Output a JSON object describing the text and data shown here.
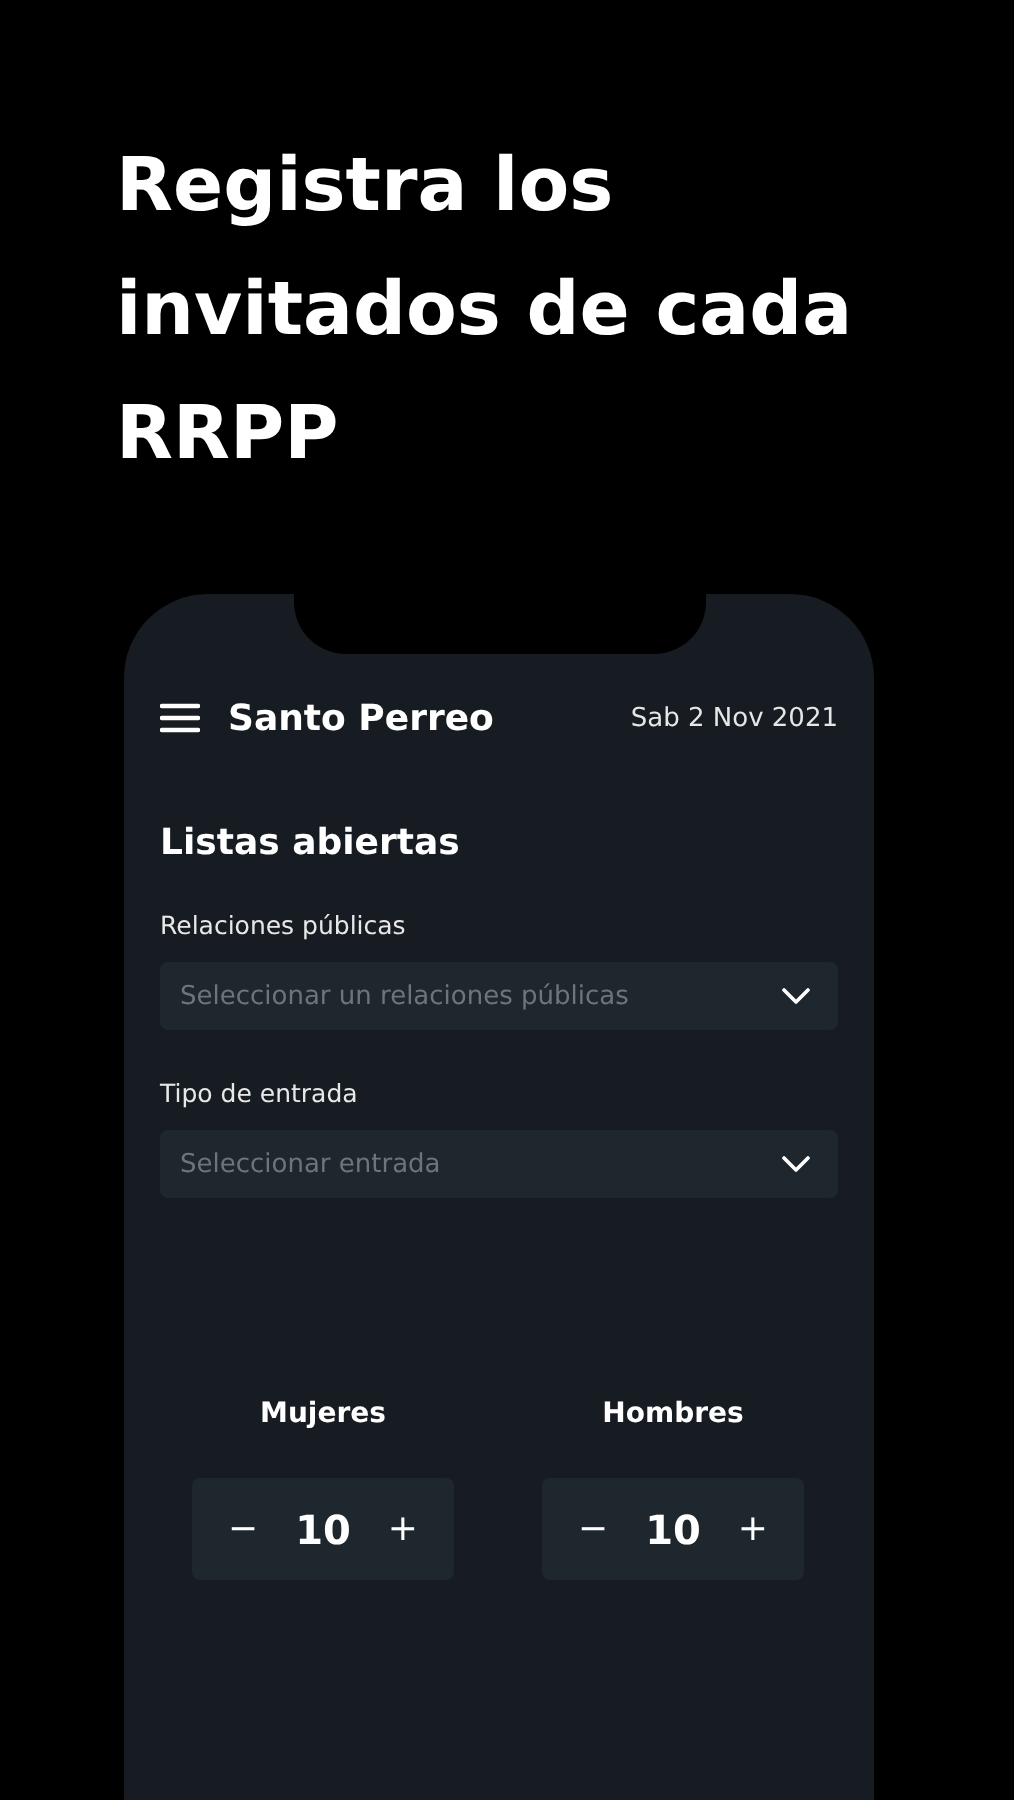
{
  "headline": "Registra los invitados de cada RRPP",
  "app": {
    "title": "Santo Perreo",
    "date": "Sab 2 Nov 2021",
    "section_title": "Listas abiertas",
    "fields": [
      {
        "label": "Relaciones públicas",
        "placeholder": "Seleccionar un relaciones públicas"
      },
      {
        "label": "Tipo de entrada",
        "placeholder": "Seleccionar entrada"
      }
    ],
    "counters": [
      {
        "label": "Mujeres",
        "decrement": "−",
        "value": "10",
        "increment": "+"
      },
      {
        "label": "Hombres",
        "decrement": "−",
        "value": "10",
        "increment": "+"
      }
    ]
  }
}
